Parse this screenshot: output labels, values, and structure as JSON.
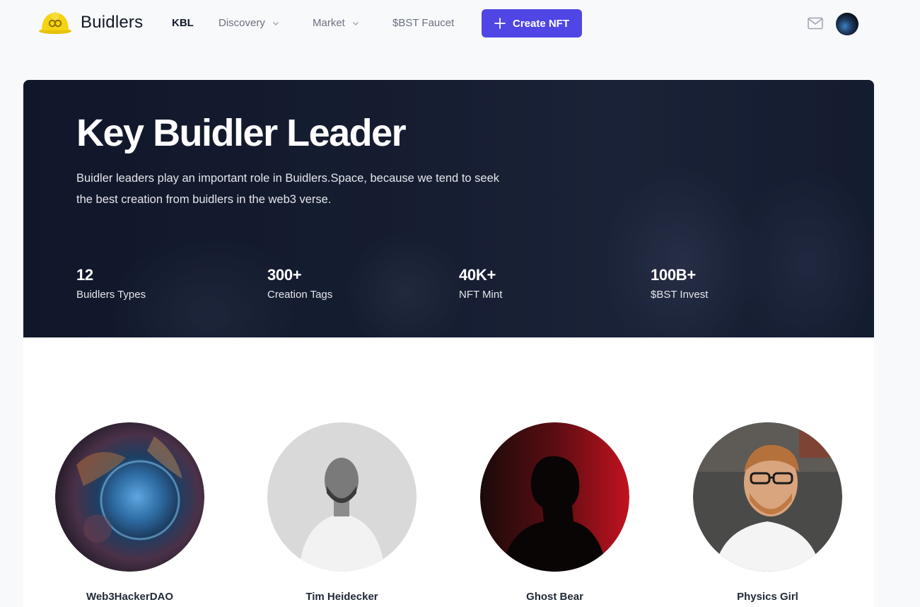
{
  "header": {
    "brand": "Buidlers",
    "nav": [
      {
        "label": "KBL",
        "active": true,
        "dropdown": false
      },
      {
        "label": "Discovery",
        "active": false,
        "dropdown": true
      },
      {
        "label": "Market",
        "active": false,
        "dropdown": true
      },
      {
        "label": "$BST Faucet",
        "active": false,
        "dropdown": false
      }
    ],
    "create_label": "Create NFT",
    "icons": [
      "hardhat-logo-icon",
      "chevron-down-icon",
      "plus-icon",
      "mail-icon",
      "user-avatar"
    ]
  },
  "hero": {
    "title": "Key Buidler Leader",
    "description_line1": "Buidler leaders play an important role in Buidlers.Space, because we tend to seek",
    "description_line2": "the best creation from buidlers in the web3 verse.",
    "stats": [
      {
        "value": "12",
        "label": "Buidlers Types"
      },
      {
        "value": "300+",
        "label": "Creation Tags"
      },
      {
        "value": "40K+",
        "label": "NFT Mint"
      },
      {
        "value": "100B+",
        "label": "$BST Invest"
      }
    ]
  },
  "leaders": [
    {
      "name": "Web3HackerDAO"
    },
    {
      "name": "Tim Heidecker"
    },
    {
      "name": "Ghost Bear"
    },
    {
      "name": "Physics Girl"
    }
  ],
  "colors": {
    "accent": "#4f46e5",
    "page_bg": "#f8f9fb",
    "logo_yellow": "#f5d311"
  }
}
